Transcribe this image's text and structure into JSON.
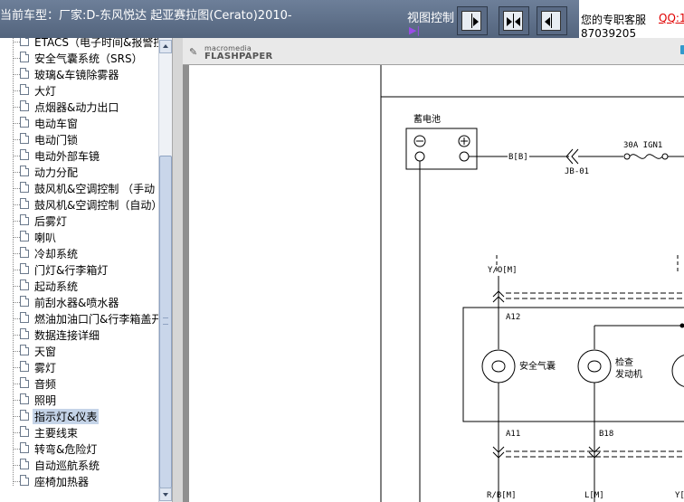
{
  "header": {
    "car_model": "当前车型：厂家:D-东风悦达 起亚赛拉图(Cerato)2010-",
    "view_control_label": "视图控制",
    "view_control_arrow": "▶|",
    "buttons": [
      "align-right",
      "fit-both",
      "align-left"
    ],
    "service_label": "您的专职客服",
    "service_qq": "QQ:1",
    "service_phone": "87039205"
  },
  "tree": {
    "items": [
      {
        "label": "ETACS（电子时间&报警控"
      },
      {
        "label": "安全气囊系统（SRS）"
      },
      {
        "label": "玻璃&车镜除雾器"
      },
      {
        "label": "大灯"
      },
      {
        "label": "点烟器&动力出口"
      },
      {
        "label": "电动车窗"
      },
      {
        "label": "电动门锁"
      },
      {
        "label": "电动外部车镜"
      },
      {
        "label": "动力分配"
      },
      {
        "label": "鼓风机&空调控制 （手动"
      },
      {
        "label": "鼓风机&空调控制（自动）"
      },
      {
        "label": "后雾灯"
      },
      {
        "label": "喇叭"
      },
      {
        "label": "冷却系统"
      },
      {
        "label": "门灯&行李箱灯"
      },
      {
        "label": "起动系统"
      },
      {
        "label": "前刮水器&喷水器"
      },
      {
        "label": "燃油加油口门&行李箱盖开"
      },
      {
        "label": "数据连接详细"
      },
      {
        "label": "天窗"
      },
      {
        "label": "雾灯"
      },
      {
        "label": "音频"
      },
      {
        "label": "照明"
      },
      {
        "label": "指示灯&仪表",
        "selected": true
      },
      {
        "label": "主要线束"
      },
      {
        "label": "转弯&危险灯"
      },
      {
        "label": "自动巡航系统"
      },
      {
        "label": "座椅加热器"
      }
    ]
  },
  "viewer": {
    "brand_small": "macromedia",
    "brand_big": "FLASHPAPER",
    "diagram": {
      "battery_label": "蓄电池",
      "wire_b": "B[B]",
      "connector_jb": "JB-01",
      "fuse_label": "30A IGN1",
      "wire_yo": "Y/O[M]",
      "pin_a12": "A12",
      "lamp1_label": "安全气囊",
      "lamp2_label_1": "检查",
      "lamp2_label_2": "发动机",
      "pin_a11": "A11",
      "pin_b18": "B18",
      "wire_rb": "R/B[M]",
      "wire_l": "L[M]",
      "wire_y": "Y["
    }
  },
  "colors": {
    "header_bg": "#5d6e88",
    "selection": "#c5d4e8",
    "service_qq": "#e00000"
  }
}
